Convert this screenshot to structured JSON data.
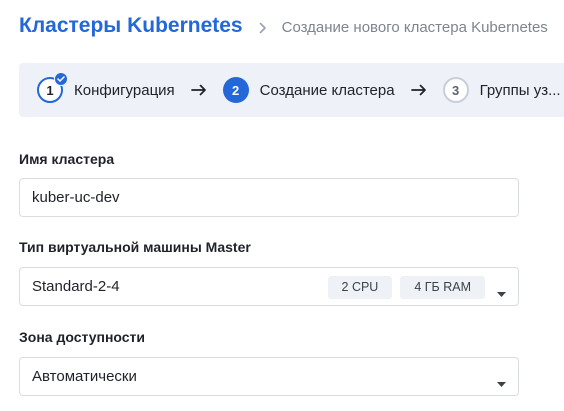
{
  "breadcrumb": {
    "root": "Кластеры Kubernetes",
    "current": "Создание нового кластера Kubernetes"
  },
  "stepper": {
    "steps": [
      {
        "number": "1",
        "label": "Конфигурация",
        "state": "done"
      },
      {
        "number": "2",
        "label": "Создание кластера",
        "state": "active"
      },
      {
        "number": "3",
        "label": "Группы уз...",
        "state": "todo"
      }
    ]
  },
  "form": {
    "cluster_name": {
      "label": "Имя кластера",
      "value": "kuber-uc-dev"
    },
    "master_vm": {
      "label": "Тип виртуальной машины Master",
      "value": "Standard-2-4",
      "cpu": "2 CPU",
      "ram": "4 ГБ RAM"
    },
    "zone": {
      "label": "Зона доступности",
      "value": "Автоматически"
    }
  },
  "colors": {
    "accent": "#2367d9",
    "stepper_bg": "#eef2f8",
    "border": "#d9dde3"
  }
}
